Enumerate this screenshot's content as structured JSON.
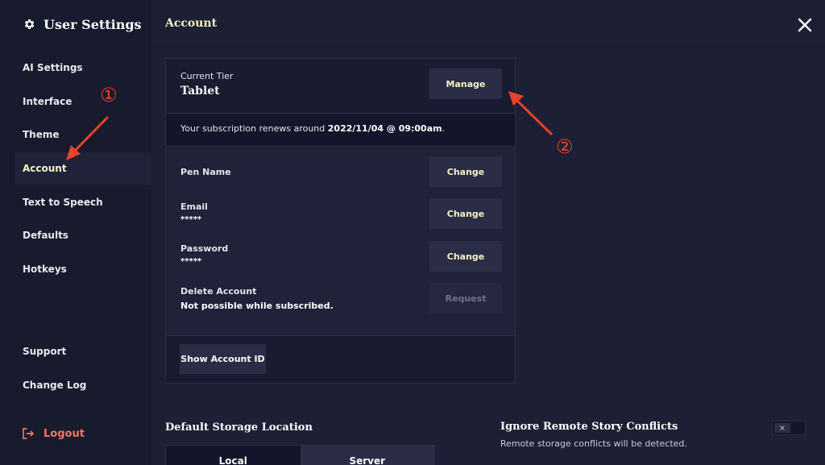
{
  "sidebar": {
    "title": "User Settings",
    "items": [
      {
        "label": "AI Settings"
      },
      {
        "label": "Interface"
      },
      {
        "label": "Theme"
      },
      {
        "label": "Account"
      },
      {
        "label": "Text to Speech"
      },
      {
        "label": "Defaults"
      },
      {
        "label": "Hotkeys"
      },
      {
        "label": "Support"
      },
      {
        "label": "Change Log"
      }
    ],
    "active_item": "Account",
    "logout_label": "Logout"
  },
  "header": {
    "title": "Account"
  },
  "account": {
    "tier_label": "Current Tier",
    "tier_value": "Tablet",
    "manage_label": "Manage",
    "renew_prefix": "Your subscription renews around ",
    "renew_date": "2022/11/04 @ 09:00am",
    "renew_suffix": ".",
    "rows": [
      {
        "label": "Pen Name",
        "value": "",
        "button": "Change",
        "enabled": true
      },
      {
        "label": "Email",
        "value": "*****",
        "button": "Change",
        "enabled": true
      },
      {
        "label": "Password",
        "value": "*****",
        "button": "Change",
        "enabled": true
      },
      {
        "label": "Delete Account",
        "value": "Not possible while subscribed.",
        "button": "Request",
        "enabled": false
      }
    ],
    "show_id_label": "Show Account ID"
  },
  "storage": {
    "title": "Default Storage Location",
    "options": [
      "Local",
      "Server"
    ]
  },
  "conflicts": {
    "title": "Ignore Remote Story Conflicts",
    "description": "Remote storage conflicts will be detected.",
    "toggle_symbol": "×"
  },
  "annotations": {
    "marker_1": "①",
    "marker_2": "②"
  },
  "colors": {
    "accent": "#f5f3c2",
    "annotation": "#e8432a",
    "logout": "#f27766"
  }
}
